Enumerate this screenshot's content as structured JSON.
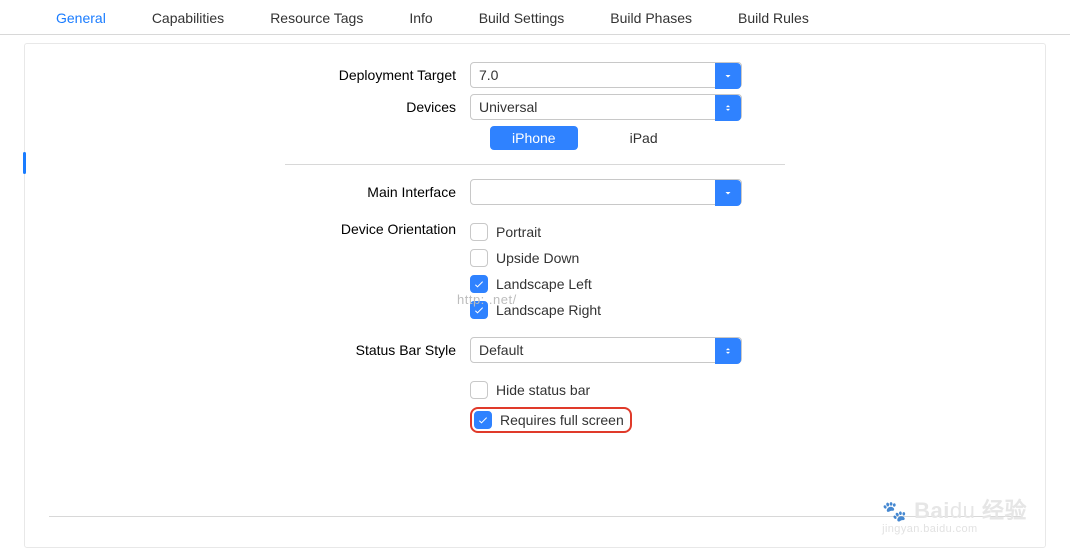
{
  "tabs": [
    "General",
    "Capabilities",
    "Resource Tags",
    "Info",
    "Build Settings",
    "Build Phases",
    "Build Rules"
  ],
  "activeTabIndex": 0,
  "labels": {
    "deploymentTarget": "Deployment Target",
    "devices": "Devices",
    "mainInterface": "Main Interface",
    "deviceOrientation": "Device Orientation",
    "statusBarStyle": "Status Bar Style"
  },
  "values": {
    "deploymentTarget": "7.0",
    "devices": "Universal",
    "mainInterface": "",
    "statusBarStyle": "Default"
  },
  "segments": {
    "iphone": "iPhone",
    "ipad": "iPad"
  },
  "orientation": {
    "portrait": {
      "label": "Portrait",
      "checked": false
    },
    "upsideDown": {
      "label": "Upside Down",
      "checked": false
    },
    "landscapeLeft": {
      "label": "Landscape Left",
      "checked": true
    },
    "landscapeRight": {
      "label": "Landscape Right",
      "checked": true
    }
  },
  "statusOptions": {
    "hideStatusBar": {
      "label": "Hide status bar",
      "checked": false
    },
    "requiresFullScreen": {
      "label": "Requires full screen",
      "checked": true
    }
  },
  "watermark": {
    "url": "http:                 .net/",
    "brand": "Bai",
    "brandSuffix": "经验",
    "subline": "jingyan.baidu.com"
  }
}
